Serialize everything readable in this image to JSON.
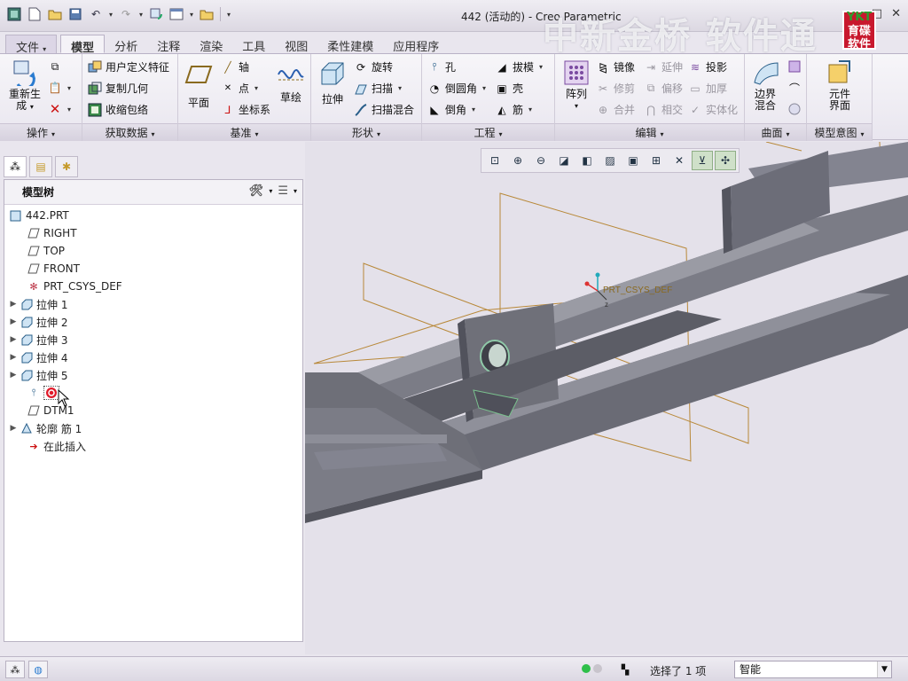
{
  "window": {
    "title": "442 (活动的) - Creo Parametric",
    "watermark": "中新金桥 软件通",
    "logo_text": "育碟软件",
    "logo_top": "YKT"
  },
  "quick_access": [
    "new-icon",
    "open-icon",
    "save-icon",
    "undo-icon",
    "redo-icon",
    "regenerate-icon",
    "windows-icon",
    "close-icon",
    "customize-icon"
  ],
  "tabs": [
    {
      "label": "文件",
      "dropdown": "▾"
    },
    {
      "label": "模型"
    },
    {
      "label": "分析"
    },
    {
      "label": "注释"
    },
    {
      "label": "渲染"
    },
    {
      "label": "工具"
    },
    {
      "label": "视图"
    },
    {
      "label": "柔性建模"
    },
    {
      "label": "应用程序"
    }
  ],
  "ribbon": {
    "operations": {
      "label": "操作",
      "regen_line1": "重新生",
      "regen_line2": "成"
    },
    "get_data": {
      "label": "获取数据",
      "udf": "用户定义特征",
      "copy_geom": "复制几何",
      "shrinkwrap": "收缩包络"
    },
    "datum": {
      "label": "基准",
      "plane": "平面",
      "axis": "轴",
      "point": "点",
      "csys": "坐标系",
      "sketch": "草绘"
    },
    "shapes": {
      "label": "形状",
      "extrude": "拉伸",
      "revolve": "旋转",
      "sweep": "扫描",
      "swept_blend": "扫描混合"
    },
    "engineering": {
      "label": "工程",
      "hole": "孔",
      "round": "倒圆角",
      "chamfer": "倒角",
      "draft": "拔模",
      "shell": "壳",
      "rib": "筋"
    },
    "editing": {
      "label": "编辑",
      "pattern": "阵列",
      "mirror": "镜像",
      "trim": "修剪",
      "merge": "合并",
      "extend": "延伸",
      "offset": "偏移",
      "intersect": "相交",
      "project": "投影",
      "thicken": "加厚",
      "solidify": "实体化"
    },
    "surfaces": {
      "label": "曲面",
      "boundary_line1": "边界",
      "boundary_line2": "混合"
    },
    "model_intent": {
      "label": "模型意图",
      "component_line1": "元件",
      "component_line2": "界面"
    }
  },
  "model_tree": {
    "title": "模型树",
    "items": [
      {
        "label": "442.PRT",
        "icon": "part-icon",
        "expandable": false
      },
      {
        "label": "RIGHT",
        "icon": "datum-plane-icon",
        "expandable": false
      },
      {
        "label": "TOP",
        "icon": "datum-plane-icon",
        "expandable": false
      },
      {
        "label": "FRONT",
        "icon": "datum-plane-icon",
        "expandable": false
      },
      {
        "label": "PRT_CSYS_DEF",
        "icon": "csys-icon",
        "expandable": false
      },
      {
        "label": "拉伸 1",
        "icon": "extrude-icon",
        "expandable": true
      },
      {
        "label": "拉伸 2",
        "icon": "extrude-icon",
        "expandable": true
      },
      {
        "label": "拉伸 3",
        "icon": "extrude-icon",
        "expandable": true
      },
      {
        "label": "拉伸 4",
        "icon": "extrude-icon",
        "expandable": true
      },
      {
        "label": "拉伸 5",
        "icon": "extrude-icon",
        "expandable": true
      },
      {
        "label": "",
        "icon": "hole-icon",
        "expandable": false
      },
      {
        "label": "DTM1",
        "icon": "datum-plane-icon",
        "expandable": false
      },
      {
        "label": "轮廓 筋 1",
        "icon": "rib-icon",
        "expandable": true
      },
      {
        "label": "在此插入",
        "icon": "insert-arrow-icon",
        "expandable": false
      }
    ]
  },
  "graphics": {
    "csys_label": "PRT_CSYS_DEF",
    "toolbar": [
      "refit-icon",
      "zoom-in-icon",
      "zoom-out-icon",
      "repaint-icon",
      "display-style-icon",
      "saved-views-icon",
      "view-manager-icon",
      "perspective-icon",
      "datum-display-icon",
      "annotation-display-icon",
      "spin-center-icon"
    ]
  },
  "status": {
    "selection": "选择了 1 项",
    "filter": "智能"
  },
  "colors": {
    "model_gray": "#6e6f78",
    "datum_orange": "#b88838",
    "accent_red": "#c8182d"
  }
}
